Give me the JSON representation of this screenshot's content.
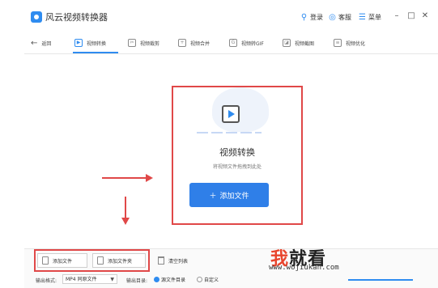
{
  "app": {
    "title": "风云视频转换器"
  },
  "titlebar": {
    "login_label": "登录",
    "service_label": "客服",
    "menu_label": "菜单",
    "min": "–",
    "max": "□",
    "close": "✕"
  },
  "nav": {
    "back": "返回",
    "items": [
      {
        "label": "视频转换",
        "icon": "video-convert-icon",
        "active": true
      },
      {
        "label": "视频裁剪",
        "icon": "video-cut-icon"
      },
      {
        "label": "视频合并",
        "icon": "video-merge-icon"
      },
      {
        "label": "视频转GIF",
        "icon": "video-gif-icon"
      },
      {
        "label": "视频截图",
        "icon": "video-screenshot-icon"
      },
      {
        "label": "视频优化",
        "icon": "video-optimize-icon"
      }
    ]
  },
  "drop": {
    "title": "视频转换",
    "subtitle": "将视频文件拖拽到此处",
    "add_button": "添加文件"
  },
  "toolbar": {
    "add_file": "添加文件",
    "add_folder": "添加文件夹",
    "clear_list": "清空列表",
    "output_format_label": "输出格式:",
    "output_format_value": "MP4 同原文件",
    "output_dir_label": "输出目录:",
    "source_dir_option": "源文件目录",
    "custom_option": "自定义"
  },
  "watermark": {
    "brand_first": "我",
    "brand_rest": "就看",
    "url": "www.wojiukan.com"
  },
  "colors": {
    "accent": "#2f7fe8",
    "annotation_red": "#e04848"
  }
}
